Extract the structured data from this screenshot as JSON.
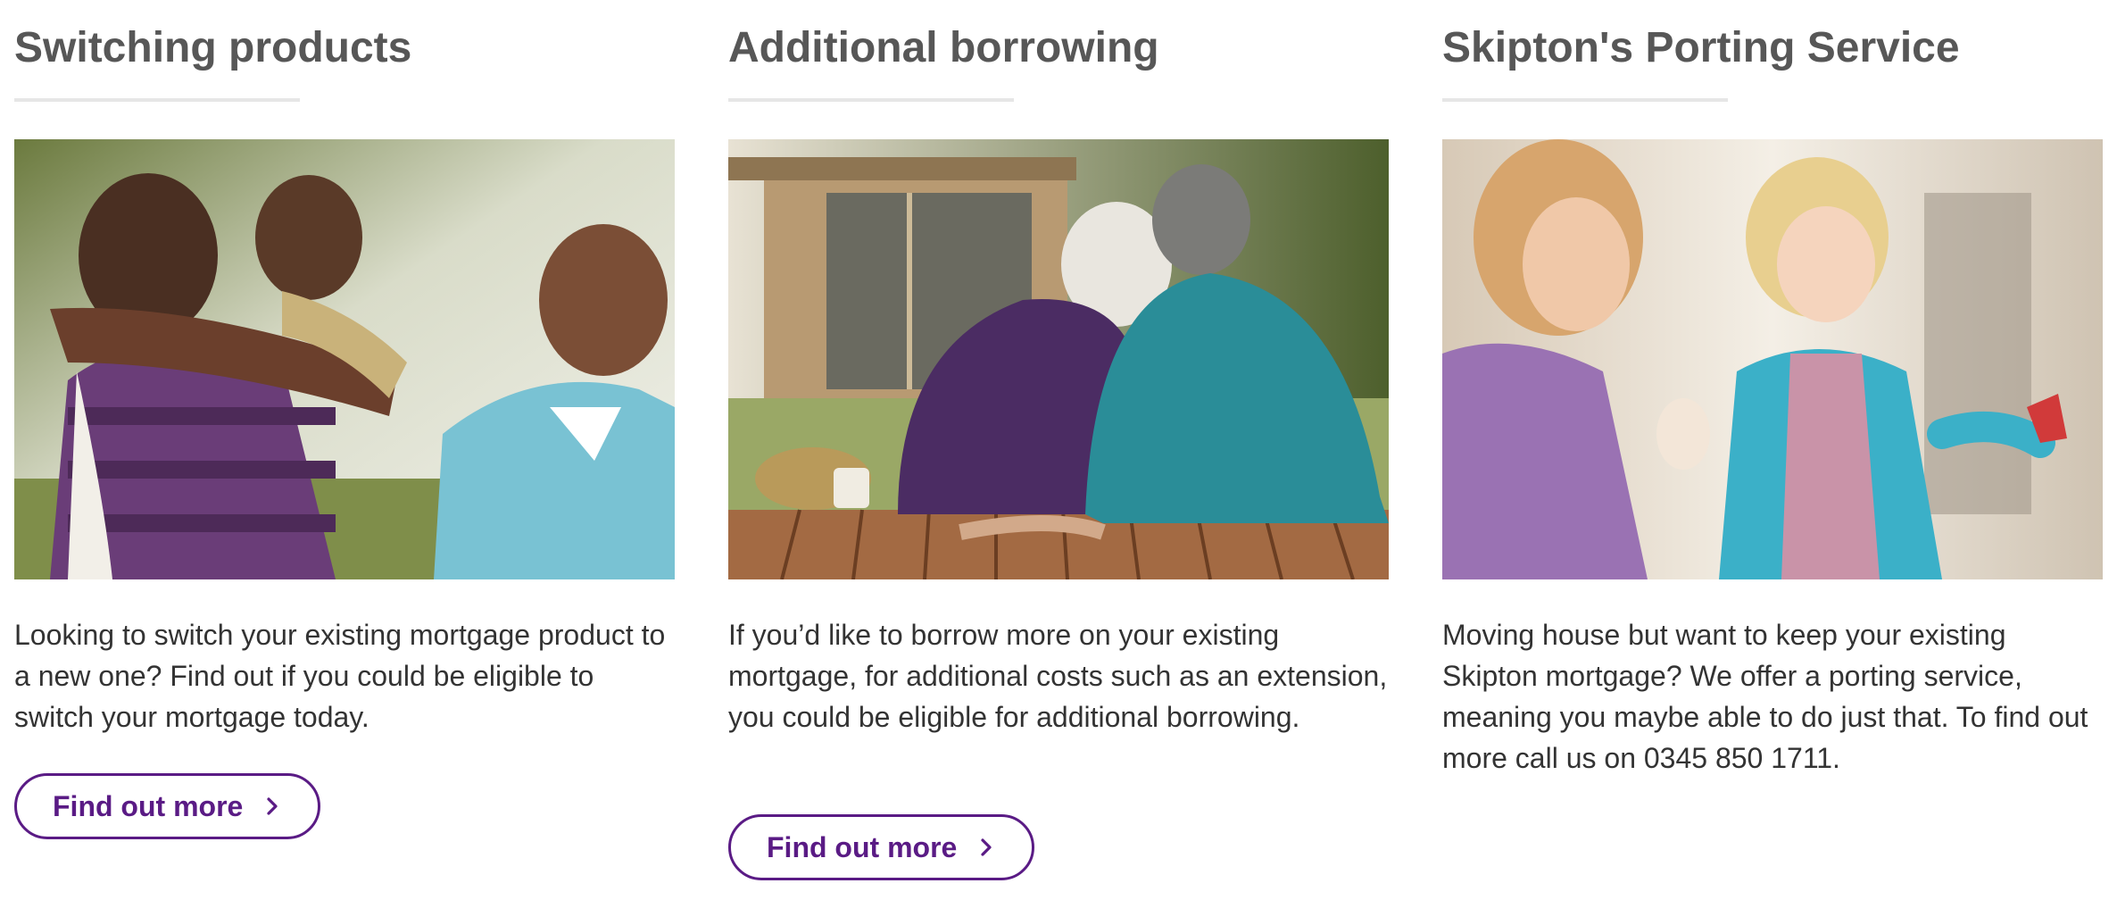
{
  "cards": [
    {
      "title": "Switching products",
      "image_alt": "Father carrying son on his back laughing with grandfather outdoors",
      "description": "Looking to switch your existing mortgage product to a new one? Find out if you could be eligible to switch your mortgage today.",
      "cta_label": "Find out more"
    },
    {
      "title": "Additional borrowing",
      "image_alt": "Older couple sitting together on a wooden deck facing a garden office",
      "description": "If you’d like to borrow more on your existing mortgage, for additional costs such as an extension, you could be eligible for additional borrowing.",
      "cta_label": "Find out more"
    },
    {
      "title": "Skipton's Porting Service",
      "image_alt": "Mother and young daughter laughing together in a bright kitchen",
      "description": "Moving house but want to keep your existing Skipton mortgage? We offer a porting service, meaning you maybe able to do just that. To find out more call us on 0345 850 1711."
    }
  ],
  "colors": {
    "brand_purple": "#5a1b85",
    "heading_gray": "#575757",
    "body_text": "#333333",
    "divider": "#e6e6e6"
  },
  "icons": {
    "cta_icon": "chevron-right-icon"
  }
}
